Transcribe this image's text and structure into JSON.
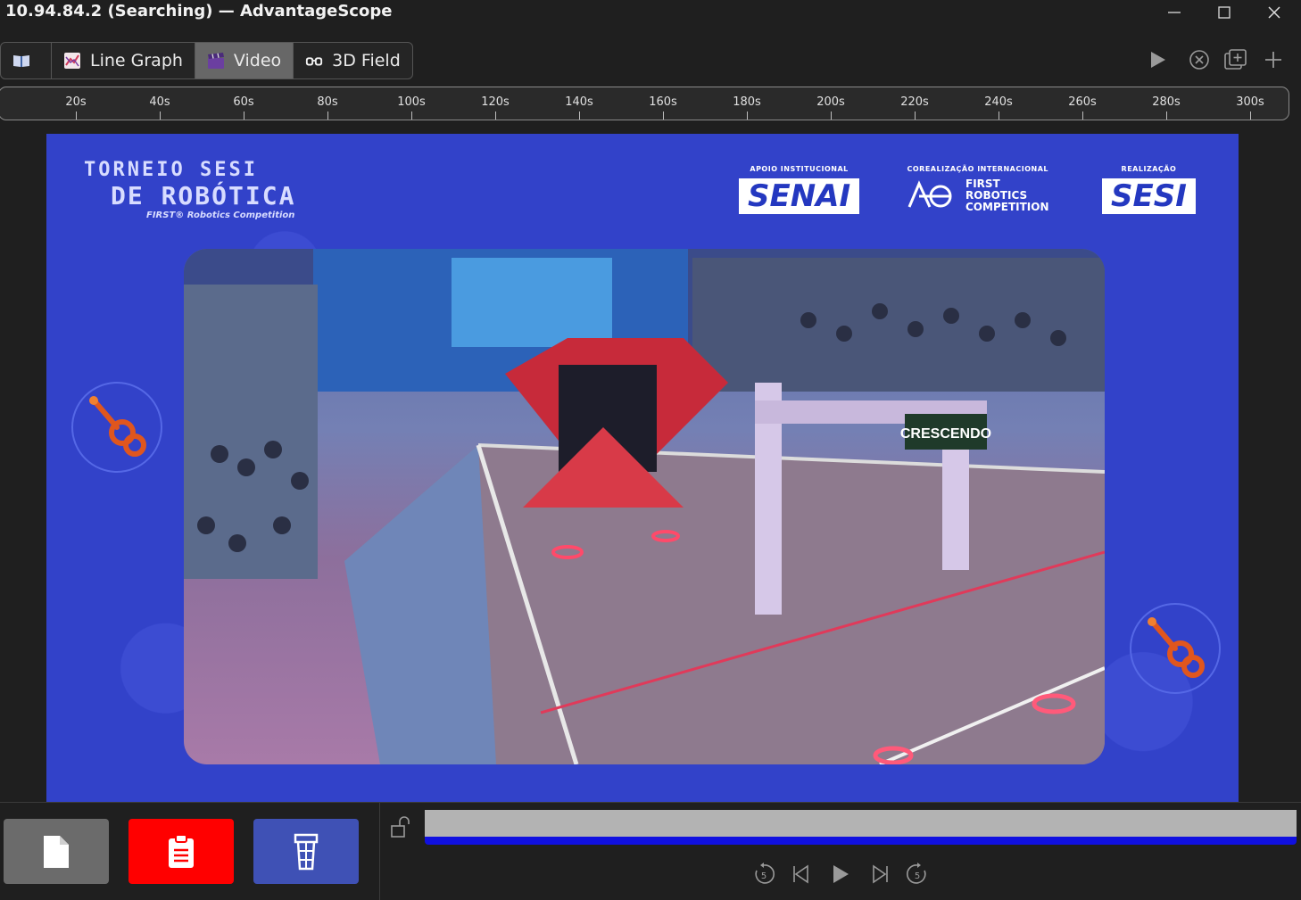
{
  "window": {
    "title": "10.94.84.2 (Searching) — AdvantageScope"
  },
  "tabs": [
    {
      "label": "",
      "icon": "book-icon",
      "active": false
    },
    {
      "label": "Line Graph",
      "icon": "line-graph-icon",
      "active": false
    },
    {
      "label": "Video",
      "icon": "clapper-icon",
      "active": true
    },
    {
      "label": "3D Field",
      "icon": "glasses-icon",
      "active": false
    }
  ],
  "timeline": {
    "ticks": [
      "20s",
      "40s",
      "60s",
      "80s",
      "100s",
      "120s",
      "140s",
      "160s",
      "180s",
      "200s",
      "220s",
      "240s",
      "260s",
      "280s",
      "300s"
    ]
  },
  "video": {
    "brand_line1": "TORNEIO SESI",
    "brand_line2": "DE ROBÓTICA",
    "brand_line3": "FIRST® Robotics Competition",
    "sponsor1_caption": "APOIO INSTITUCIONAL",
    "sponsor1_logo": "SENAI",
    "sponsor2_caption": "COREALIZAÇÃO INTERNACIONAL",
    "sponsor2_line1": "FIRST",
    "sponsor2_line2": "ROBOTICS",
    "sponsor2_line3": "COMPETITION",
    "sponsor3_caption": "REALIZAÇÃO",
    "sponsor3_logo": "SESI",
    "sign_text": "CRESCENDO"
  },
  "colors": {
    "source_file": "#6b6b6b",
    "source_clipboard": "#ff0000",
    "source_tower": "#3f51b5",
    "scrub_track": "#b3b3b3",
    "scrub_fill": "#1010e0",
    "active_tab": "#676767"
  },
  "playback": {
    "scrub_progress": 1.0,
    "skip_back_label": "5",
    "skip_forward_label": "5"
  }
}
